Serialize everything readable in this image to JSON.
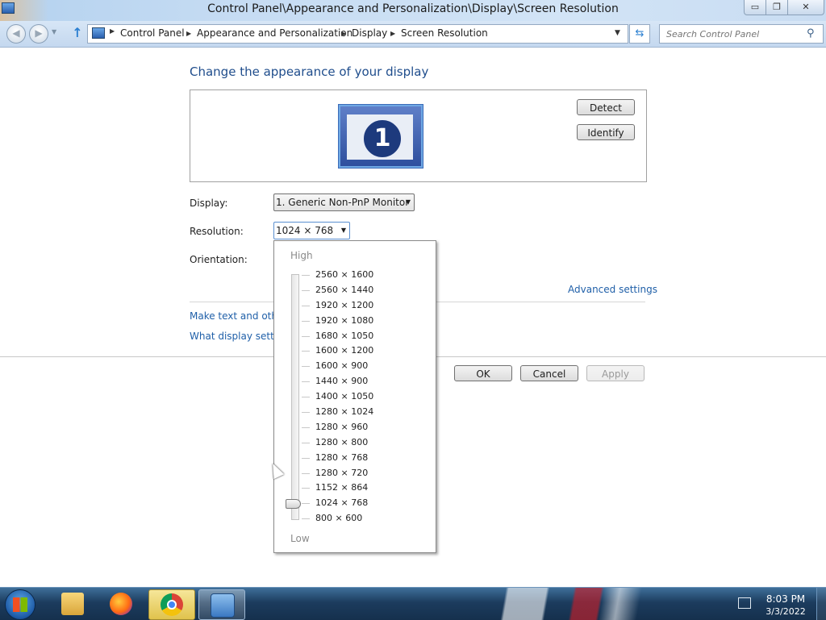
{
  "window": {
    "title": "Control Panel\\Appearance and Personalization\\Display\\Screen Resolution",
    "minimize_glyph": "▭",
    "maximize_glyph": "❐",
    "close_glyph": "✕"
  },
  "address_bar": {
    "breadcrumbs": [
      "Control Panel",
      "Appearance and Personalization",
      "Display",
      "Screen Resolution"
    ],
    "search_placeholder": "Search Control Panel",
    "icons": [
      "back-icon",
      "forward-icon",
      "up-icon",
      "control-panel-icon",
      "refresh-icon",
      "search-icon"
    ]
  },
  "main": {
    "title": "Change the appearance of your display",
    "monitor_number": "1",
    "detect_label": "Detect",
    "identify_label": "Identify",
    "display_label": "Display:",
    "display_value": "1. Generic Non-PnP Monitor",
    "resolution_label": "Resolution:",
    "resolution_value": "1024 × 768",
    "orientation_label": "Orientation:",
    "advanced_link": "Advanced settings",
    "text_size_link": "Make text and other",
    "what_settings_link": "What display setting",
    "ok_label": "OK",
    "cancel_label": "Cancel",
    "apply_label": "Apply"
  },
  "resolution_popup": {
    "high_label": "High",
    "low_label": "Low",
    "options": [
      "2560 × 1600",
      "2560 × 1440",
      "1920 × 1200",
      "1920 × 1080",
      "1680 × 1050",
      "1600 × 1200",
      "1600 × 900",
      "1440 × 900",
      "1400 × 1050",
      "1280 × 1024",
      "1280 × 960",
      "1280 × 800",
      "1280 × 768",
      "1280 × 720",
      "1152 × 864",
      "1024 × 768",
      "800 × 600"
    ],
    "selected": "1024 × 768"
  },
  "taskbar": {
    "items": [
      "windows-explorer",
      "firefox",
      "chrome",
      "control-panel"
    ],
    "active": "chrome",
    "clock_time": "8:03 PM",
    "clock_date": "3/3/2022"
  },
  "colors": {
    "link": "#1f5fa8",
    "title": "#1f4d8c",
    "taskbar": "#1c3c5e"
  }
}
